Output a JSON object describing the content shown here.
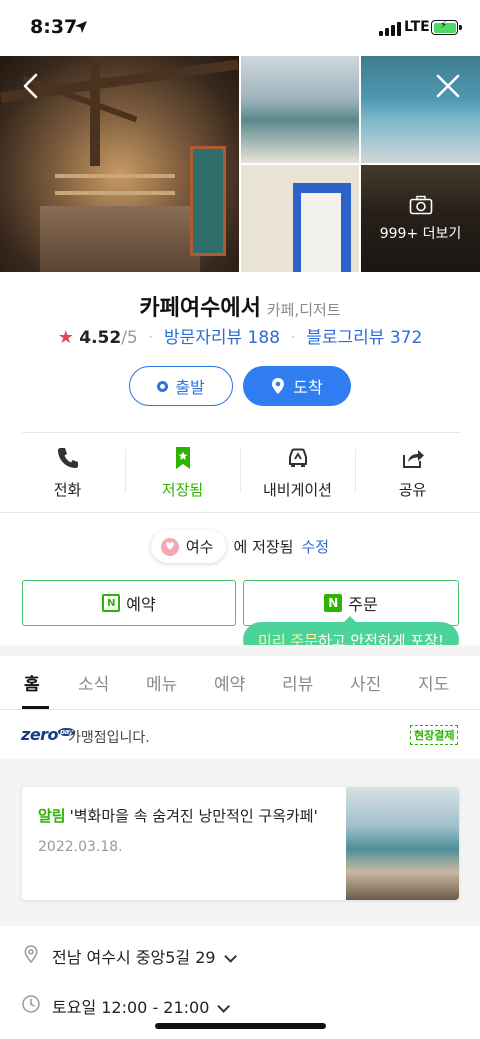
{
  "status_bar": {
    "time": "8:37",
    "network": "LTE"
  },
  "gallery": {
    "more_label": "999+ 더보기"
  },
  "place": {
    "name": "카페여수에서",
    "category": "카페,디저트",
    "rating": "4.52",
    "rating_max": "/5",
    "visitor_review": "방문자리뷰 188",
    "blog_review": "블로그리뷰 372"
  },
  "route": {
    "start_label": "출발",
    "arrive_label": "도착"
  },
  "actions": [
    {
      "label": "전화",
      "icon": "phone-icon"
    },
    {
      "label": "저장됨",
      "icon": "bookmark-icon"
    },
    {
      "label": "내비게이션",
      "icon": "car-icon"
    },
    {
      "label": "공유",
      "icon": "share-icon"
    }
  ],
  "saved": {
    "folder": "여수",
    "suffix": "에 저장됨",
    "edit_label": "수정"
  },
  "booking": {
    "reserve_label": "예약",
    "order_label": "주문"
  },
  "tooltip": {
    "highlight": "미리 주문",
    "rest": "하고 안전하게 포장!"
  },
  "tabs": [
    "홈",
    "소식",
    "메뉴",
    "예약",
    "리뷰",
    "사진",
    "지도"
  ],
  "zeropay": {
    "logo": "zero",
    "text": "가맹점입니다.",
    "badge": "현장결제"
  },
  "notice": {
    "tag": "알림",
    "title": "'벽화마을 속 숨겨진 낭만적인 구옥카페'",
    "date": "2022.03.18."
  },
  "info": {
    "address": "전남 여수시 중앙5길 29",
    "hours": "토요일 12:00 - 21:00"
  },
  "colors": {
    "accent_blue": "#2f7df0",
    "naver_green": "#2db400",
    "star_red": "#e8474c"
  }
}
